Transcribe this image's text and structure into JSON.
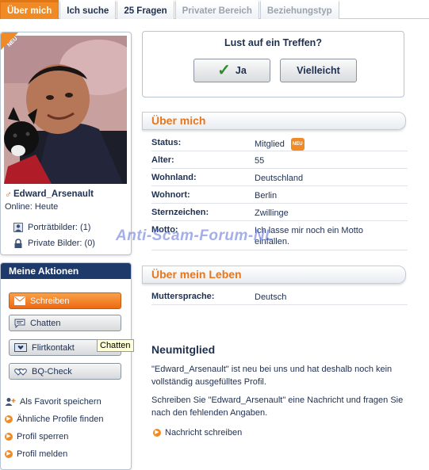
{
  "tabs": [
    {
      "label": "Über mich"
    },
    {
      "label": "Ich suche"
    },
    {
      "label": "25 Fragen"
    },
    {
      "label": "Privater Bereich"
    },
    {
      "label": "Beziehungstyp"
    }
  ],
  "profile": {
    "badge": "NEU",
    "username": "Edward_Arsenault",
    "online": "Online: Heute",
    "portrait_pics": "Porträtbilder: (1)",
    "private_pics": "Private Bilder: (0)"
  },
  "actions": {
    "title": "Meine Aktionen",
    "buttons": [
      "Schreiben",
      "Chatten",
      "Flirtkontakt",
      "BQ-Check"
    ],
    "tooltip": "Chatten",
    "links": [
      "Als Favorit speichern",
      "Ähnliche Profile finden",
      "Profil sperren",
      "Profil melden"
    ]
  },
  "meet": {
    "title": "Lust auf ein Treffen?",
    "yes": "Ja",
    "maybe": "Vielleicht"
  },
  "about": {
    "title": "Über mich",
    "rows": [
      {
        "k": "Status:",
        "v": "Mitglied",
        "badge": "NEU"
      },
      {
        "k": "Alter:",
        "v": "55"
      },
      {
        "k": "Wohnland:",
        "v": "Deutschland"
      },
      {
        "k": "Wohnort:",
        "v": "Berlin"
      },
      {
        "k": "Sternzeichen:",
        "v": "Zwillinge"
      },
      {
        "k": "Motto:",
        "v": "Ich lasse mir noch ein Motto einfallen."
      }
    ]
  },
  "life": {
    "title": "Über mein Leben",
    "rows": [
      {
        "k": "Muttersprache:",
        "v": "Deutsch"
      }
    ]
  },
  "watermark": "Anti-Scam-Forum-NL",
  "new_member": {
    "title": "Neumitglied",
    "p1": "\"Edward_Arsenault\" ist neu bei uns und hat deshalb noch kein vollständig ausgefülltes Profil.",
    "p2": "Schreiben Sie \"Edward_Arsenault\" eine Nachricht und fragen Sie nach den fehlenden Angaben.",
    "link": "Nachricht schreiben"
  },
  "colors": {
    "accent": "#f08a24",
    "navy": "#1e3a6b"
  }
}
